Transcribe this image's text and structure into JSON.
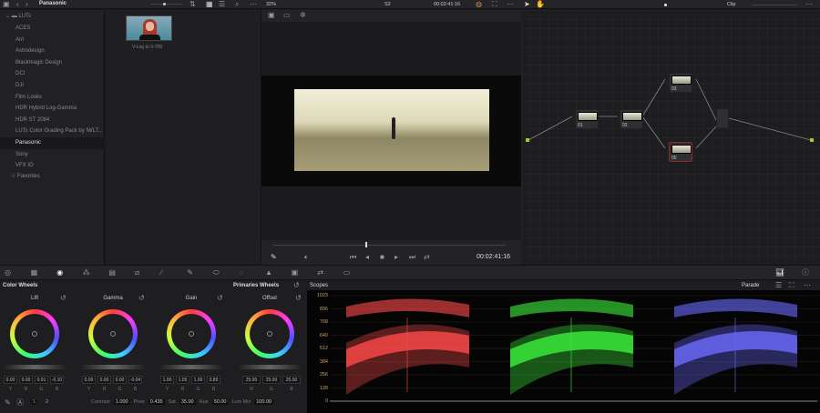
{
  "gallery": {
    "title": "Panasonic",
    "root": "LUTs",
    "items": [
      "ACES",
      "Arri",
      "Astrodesign",
      "Blackmagic Design",
      "DCI",
      "DJI",
      "Film Looks",
      "HDR Hybrid Log-Gamma",
      "HDR ST 2084",
      "LUTs Color Grading Pack by IWLT...",
      "Panasonic",
      "Sony",
      "VFX IO"
    ],
    "selected": "Panasonic",
    "favorites": "Favorites",
    "thumb_label": "V-Log to V-709"
  },
  "viewer": {
    "zoom": "32%",
    "clip": "S2",
    "timecode": "00:02:41:16",
    "timecode_bottom": "00:02:41:16",
    "playhead": 0.4
  },
  "nodes": {
    "mode": "Clip",
    "labels": [
      "01",
      "02",
      "03",
      "05"
    ]
  },
  "colorwheels": {
    "title": "Color Wheels",
    "mode": "Primaries Wheels",
    "wheels": [
      {
        "name": "Lift",
        "values": [
          "0.00",
          "0.00",
          "0.01",
          "-0.10"
        ],
        "channels": [
          "Y",
          "R",
          "G",
          "B"
        ]
      },
      {
        "name": "Gamma",
        "values": [
          "0.00",
          "0.00",
          "0.00",
          "-0.04"
        ],
        "channels": [
          "Y",
          "R",
          "G",
          "B"
        ]
      },
      {
        "name": "Gain",
        "values": [
          "1.00",
          "1.05",
          "1.00",
          "0.89"
        ],
        "channels": [
          "Y",
          "R",
          "G",
          "B"
        ]
      },
      {
        "name": "Offset",
        "values": [
          "25.00",
          "25.00",
          "25.00"
        ],
        "channels": [
          "R",
          "G",
          "B"
        ]
      }
    ],
    "page1": "1",
    "page2": "2",
    "contrast_label": "Contrast",
    "contrast": "1.000",
    "pivot_label": "Pivot",
    "pivot": "0.435",
    "sat_label": "Sat",
    "sat": "35.00",
    "hue_label": "Hue",
    "hue": "50.00",
    "lummix_label": "Lum Mix",
    "lummix": "100.00"
  },
  "scopes": {
    "title": "Scopes",
    "mode": "Parade",
    "axis": [
      "1023",
      "896",
      "768",
      "640",
      "512",
      "384",
      "256",
      "128",
      "0"
    ]
  }
}
